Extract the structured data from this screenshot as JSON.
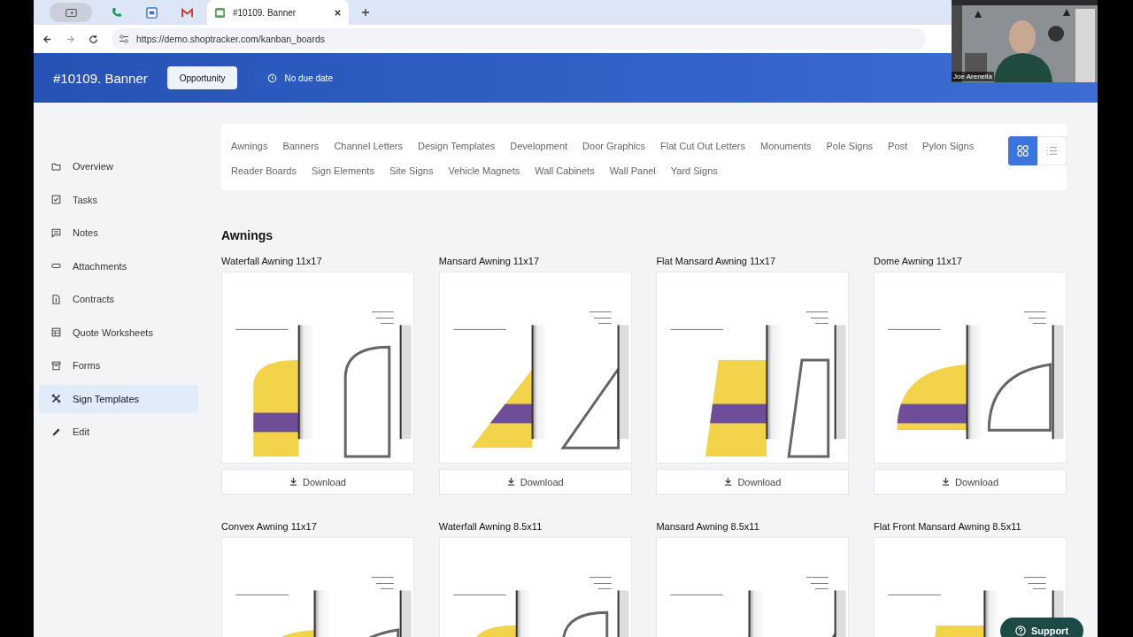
{
  "browser": {
    "tabs": [
      {
        "kind": "screen",
        "selected": false
      },
      {
        "kind": "phone",
        "selected": false
      },
      {
        "kind": "calendar",
        "selected": false
      },
      {
        "kind": "mail",
        "selected": false
      },
      {
        "kind": "page",
        "label": "#10109. Banner",
        "selected": true
      }
    ],
    "url": "https://demo.shoptracker.com/kanban_boards"
  },
  "header": {
    "title": "#10109. Banner",
    "stage": "Opportunity",
    "due": "No due date"
  },
  "sidebar": {
    "items": [
      {
        "label": "Overview",
        "selected": false
      },
      {
        "label": "Tasks",
        "selected": false
      },
      {
        "label": "Notes",
        "selected": false
      },
      {
        "label": "Attachments",
        "selected": false
      },
      {
        "label": "Contracts",
        "selected": false
      },
      {
        "label": "Quote Worksheets",
        "selected": false
      },
      {
        "label": "Forms",
        "selected": false
      },
      {
        "label": "Sign Templates",
        "selected": true
      },
      {
        "label": "Edit",
        "selected": false
      }
    ]
  },
  "categories": [
    "Awnings",
    "Banners",
    "Channel Letters",
    "Design Templates",
    "Development",
    "Door Graphics",
    "Flat Cut Out Letters",
    "Monuments",
    "Pole Signs",
    "Post",
    "Pylon Signs",
    "Reader Boards",
    "Sign Elements",
    "Site Signs",
    "Vehicle Magnets",
    "Wall Cabinets",
    "Wall Panel",
    "Yard Signs"
  ],
  "view_toggle": [
    {
      "kind": "grid",
      "selected": true
    },
    {
      "kind": "list",
      "selected": false
    }
  ],
  "section": {
    "title": "Awnings",
    "templates": [
      {
        "title": "Waterfall Awning 11x17",
        "kind": "waterfall",
        "download": "Download"
      },
      {
        "title": "Mansard Awning 11x17",
        "kind": "mansard",
        "download": "Download"
      },
      {
        "title": "Flat Mansard Awning 11x17",
        "kind": "flat_mansard",
        "download": "Download"
      },
      {
        "title": "Dome Awning 11x17",
        "kind": "dome",
        "download": "Download"
      },
      {
        "title": "Convex Awning 11x17",
        "kind": "dome"
      },
      {
        "title": "Waterfall Awning 8.5x11",
        "kind": "waterfall"
      },
      {
        "title": "Mansard Awning 8.5x11",
        "kind": "mansard"
      },
      {
        "title": "Flat Front Mansard Awning 8.5x11",
        "kind": "flat_mansard"
      }
    ]
  },
  "video": {
    "name": "Joe Arenella"
  },
  "support": "Support"
}
